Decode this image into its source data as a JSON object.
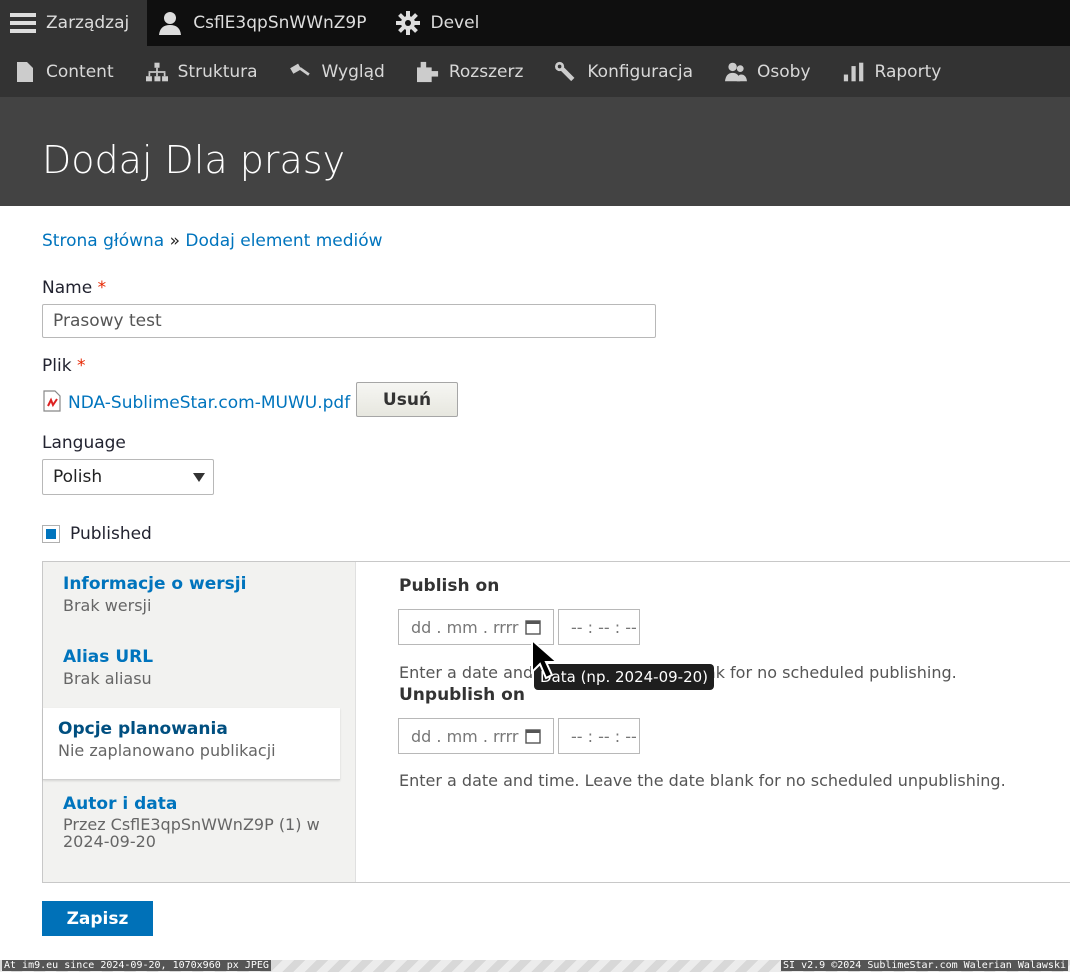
{
  "toolbar": {
    "manage": "Zarządzaj",
    "user": "CsflE3qpSnWWnZ9P",
    "devel": "Devel"
  },
  "menu": {
    "content": "Content",
    "structure": "Struktura",
    "appearance": "Wygląd",
    "extend": "Rozszerz",
    "config": "Konfiguracja",
    "people": "Osoby",
    "reports": "Raporty"
  },
  "page": {
    "title": "Dodaj Dla prasy"
  },
  "breadcrumb": {
    "home": "Strona główna",
    "sep": "»",
    "add_media": "Dodaj element mediów"
  },
  "form": {
    "name_label": "Name",
    "name_value": "Prasowy test",
    "required_mark": "*",
    "file_label": "Plik",
    "file_name": "NDA-SublimeStar.com-MUWU.pdf",
    "remove_button": "Usuń",
    "language_label": "Language",
    "language_value": "Polish",
    "published_label": "Published",
    "save_button": "Zapisz"
  },
  "vtabs": [
    {
      "title": "Informacje o wersji",
      "summary": "Brak wersji"
    },
    {
      "title": "Alias URL",
      "summary": "Brak aliasu"
    },
    {
      "title": "Opcje planowania",
      "summary": "Nie zaplanowano publikacji"
    },
    {
      "title": "Autor i data",
      "summary": "Przez CsflE3qpSnWWnZ9P (1) w 2024-09-20"
    }
  ],
  "schedule": {
    "publish_label": "Publish on",
    "unpublish_label": "Unpublish on",
    "date_placeholder": "dd . mm . rrrr",
    "time_placeholder": "-- : -- : --",
    "publish_desc_a": "Enter a date and t",
    "publish_desc_b": "nk for no scheduled publishing.",
    "unpublish_desc": "Enter a date and time. Leave the date blank for no scheduled unpublishing.",
    "tooltip": "Data (np. 2024-09-20)"
  },
  "footer": {
    "left": "At im9.eu since 2024-09-20, 1070x960 px JPEG",
    "right": "SI v2.9 ©2024 SublimeStar.com Walerian Walawski"
  }
}
